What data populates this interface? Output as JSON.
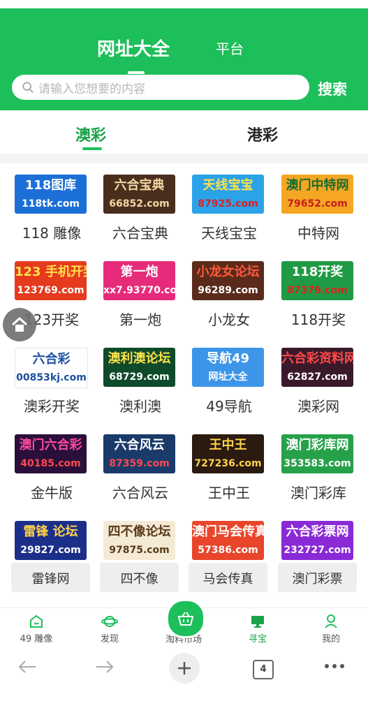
{
  "header": {
    "tab_main": "网址大全",
    "tab_platform": "平台",
    "search_placeholder": "请输入您想要的内容",
    "search_button": "搜索"
  },
  "subtabs": {
    "active": "澳彩",
    "inactive": "港彩"
  },
  "grid": [
    {
      "label": "118 雕像",
      "logo_line1": "118图库",
      "logo_line2": "118tk.com",
      "bg": "#1c6fd6",
      "fg": "#ffffff",
      "fg2": "#ffffff"
    },
    {
      "label": "六合宝典",
      "logo_line1": "六合宝典",
      "logo_line2": "66852.com",
      "bg": "#4a2e1d",
      "fg": "#f3d9a4",
      "fg2": "#f3d9a4"
    },
    {
      "label": "天线宝宝",
      "logo_line1": "天线宝宝",
      "logo_line2": "87925.com",
      "bg": "#2aa3e8",
      "fg": "#ffe14a",
      "fg2": "#e02020"
    },
    {
      "label": "中特网",
      "logo_line1": "澳门中特网",
      "logo_line2": "79652.com",
      "bg": "#f5a623",
      "fg": "#1d6b2a",
      "fg2": "#c81d1d"
    },
    {
      "label": "123开奖",
      "logo_line1": "123 手机开奖",
      "logo_line2": "123769.com",
      "bg": "#e53a1e",
      "fg": "#ffe14a",
      "fg2": "#ffffff"
    },
    {
      "label": "第一炮",
      "logo_line1": "第一炮",
      "logo_line2": "xx7.93770.com",
      "bg": "#e62b7a",
      "fg": "#ffffff",
      "fg2": "#ffffff"
    },
    {
      "label": "小龙女",
      "logo_line1": "小龙女论坛",
      "logo_line2": "96289.com",
      "bg": "#5a2a1a",
      "fg": "#ff5a3c",
      "fg2": "#ffffff"
    },
    {
      "label": "118开奖",
      "logo_line1": "118开奖",
      "logo_line2": "87379.com",
      "bg": "#1f9a45",
      "fg": "#ffffff",
      "fg2": "#e02020"
    },
    {
      "label": "澳彩开奖",
      "logo_line1": "六合彩",
      "logo_line2": "00853kj.com",
      "bg": "#ffffff",
      "fg": "#1d4fa0",
      "fg2": "#1d4fa0"
    },
    {
      "label": "澳利澳",
      "logo_line1": "澳利澳论坛",
      "logo_line2": "68729.com",
      "bg": "#0f4a2a",
      "fg": "#ffe14a",
      "fg2": "#ffffff"
    },
    {
      "label": "49导航",
      "logo_line1": "导航49",
      "logo_line2": "网址大全",
      "bg": "#3c95e8",
      "fg": "#ffffff",
      "fg2": "#ffffff"
    },
    {
      "label": "澳彩网",
      "logo_line1": "六合彩资料网",
      "logo_line2": "62827.com",
      "bg": "#3a1a2a",
      "fg": "#ff4a4a",
      "fg2": "#ffffff"
    },
    {
      "label": "金牛版",
      "logo_line1": "澳门六合彩",
      "logo_line2": "40185.com",
      "bg": "#2a0f3a",
      "fg": "#ff4aa0",
      "fg2": "#ff4a4a"
    },
    {
      "label": "六合风云",
      "logo_line1": "六合风云",
      "logo_line2": "87359.com",
      "bg": "#1a3a6a",
      "fg": "#ffffff",
      "fg2": "#ff4a4a"
    },
    {
      "label": "王中王",
      "logo_line1": "王中王",
      "logo_line2": "727236.com",
      "bg": "#2a1a10",
      "fg": "#ffd34a",
      "fg2": "#ffd34a"
    },
    {
      "label": "澳门彩库",
      "logo_line1": "澳门彩库网",
      "logo_line2": "353583.com",
      "bg": "#27a04a",
      "fg": "#ffffff",
      "fg2": "#ffffff"
    },
    {
      "label": "雷锋网",
      "logo_line1": "雷锋 论坛",
      "logo_line2": "29827.com",
      "bg": "#1b2f8a",
      "fg": "#ffd34a",
      "fg2": "#ffffff"
    },
    {
      "label": "四不像",
      "logo_line1": "四不像论坛",
      "logo_line2": "97875.com",
      "bg": "#f4ead6",
      "fg": "#5a3a1a",
      "fg2": "#5a3a1a"
    },
    {
      "label": "马会传真",
      "logo_line1": "澳门马会传真",
      "logo_line2": "57386.com",
      "bg": "#e8452a",
      "fg": "#ffffff",
      "fg2": "#ffffff"
    },
    {
      "label": "澳门彩票",
      "logo_line1": "六合彩票网",
      "logo_line2": "232727.com",
      "bg": "#8a2ad6",
      "fg": "#ffffff",
      "fg2": "#ffffff"
    }
  ],
  "bottom_nav": {
    "items": [
      {
        "label": "49 雕像",
        "icon": "house-face-icon"
      },
      {
        "label": "发现",
        "icon": "planet-icon"
      },
      {
        "label": "淘料市场",
        "icon": "basket-icon"
      },
      {
        "label": "寻宝",
        "icon": "monitor-icon"
      },
      {
        "label": "我的",
        "icon": "user-icon"
      }
    ]
  },
  "browser": {
    "tab_count": "4"
  },
  "colors": {
    "brand": "#1dbf5a",
    "active_text": "#1aa34a"
  }
}
